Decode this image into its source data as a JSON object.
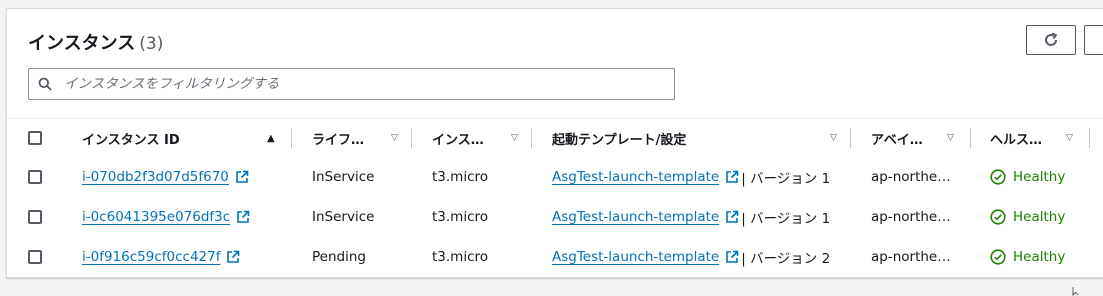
{
  "panel": {
    "title": "インスタンス",
    "count": "(3)",
    "search_placeholder": "インスタンスをフィルタリングする",
    "refresh_icon": "refresh-icon"
  },
  "columns": {
    "id": "インスタンス ID",
    "lifecycle": "ライフ…",
    "type": "インス…",
    "template": "起動テンプレート/設定",
    "az": "アベイ…",
    "health": "ヘルス…"
  },
  "rows": [
    {
      "id": "i-070db2f3d07d5f670",
      "lifecycle": "InService",
      "type": "t3.micro",
      "template": "AsgTest-launch-template",
      "version": "| バージョン 1",
      "az": "ap-northe…",
      "health": "Healthy"
    },
    {
      "id": "i-0c6041395e076df3c",
      "lifecycle": "InService",
      "type": "t3.micro",
      "template": "AsgTest-launch-template",
      "version": "| バージョン 1",
      "az": "ap-northe…",
      "health": "Healthy"
    },
    {
      "id": "i-0f916c59cf0cc427f",
      "lifecycle": "Pending",
      "type": "t3.micro",
      "template": "AsgTest-launch-template",
      "version": "| バージョン 2",
      "az": "ap-northe…",
      "health": "Healthy"
    }
  ],
  "colors": {
    "link": "#0073bb",
    "healthy": "#1d8102"
  }
}
